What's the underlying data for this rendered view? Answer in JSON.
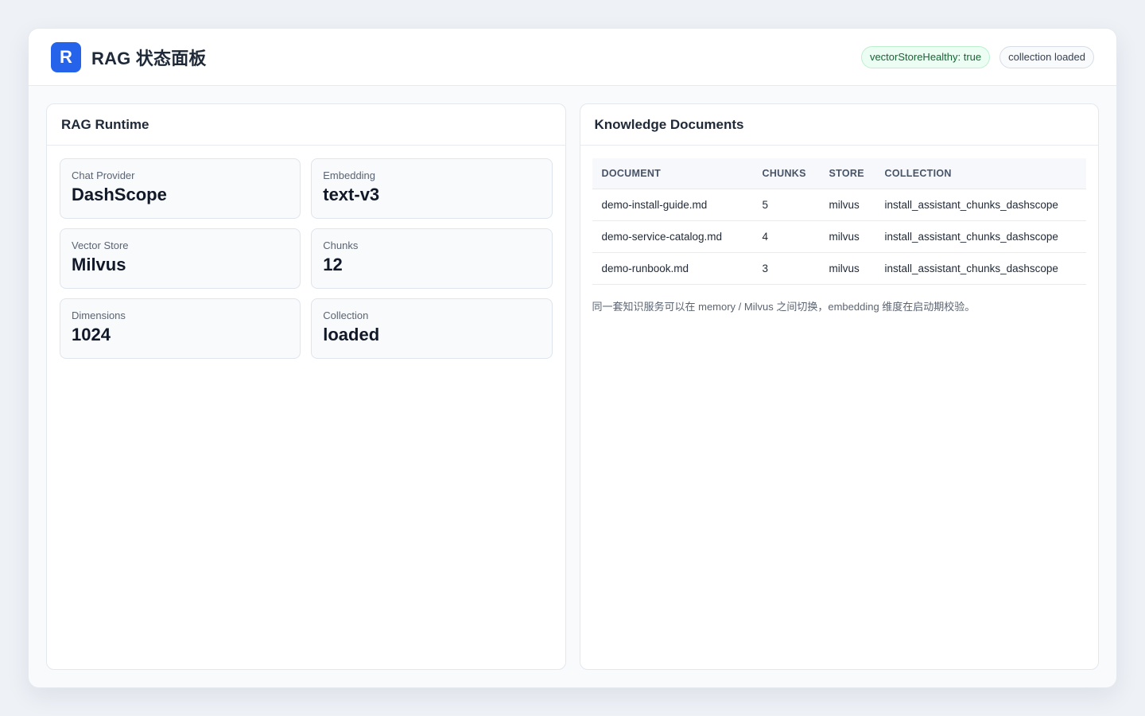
{
  "header": {
    "logo_letter": "R",
    "title": "RAG 状态面板",
    "badges": [
      "vectorStoreHealthy: true",
      "collection loaded"
    ]
  },
  "runtime": {
    "title": "RAG Runtime",
    "stats": [
      {
        "label": "Chat Provider",
        "value": "DashScope"
      },
      {
        "label": "Embedding",
        "value": "text-v3"
      },
      {
        "label": "Vector Store",
        "value": "Milvus"
      },
      {
        "label": "Chunks",
        "value": "12"
      },
      {
        "label": "Dimensions",
        "value": "1024"
      },
      {
        "label": "Collection",
        "value": "loaded"
      }
    ]
  },
  "documents": {
    "title": "Knowledge Documents",
    "columns": [
      "DOCUMENT",
      "CHUNKS",
      "STORE",
      "COLLECTION"
    ],
    "rows": [
      {
        "document": "demo-install-guide.md",
        "chunks": "5",
        "store": "milvus",
        "collection": "install_assistant_chunks_dashscope"
      },
      {
        "document": "demo-service-catalog.md",
        "chunks": "4",
        "store": "milvus",
        "collection": "install_assistant_chunks_dashscope"
      },
      {
        "document": "demo-runbook.md",
        "chunks": "3",
        "store": "milvus",
        "collection": "install_assistant_chunks_dashscope"
      }
    ],
    "note": "同一套知识服务可以在 memory / Milvus 之间切换，embedding 维度在启动期校验。"
  },
  "colors": {
    "accent": "#2563eb",
    "healthy_badge_bg": "#ecfdf3",
    "healthy_badge_text": "#166534"
  }
}
